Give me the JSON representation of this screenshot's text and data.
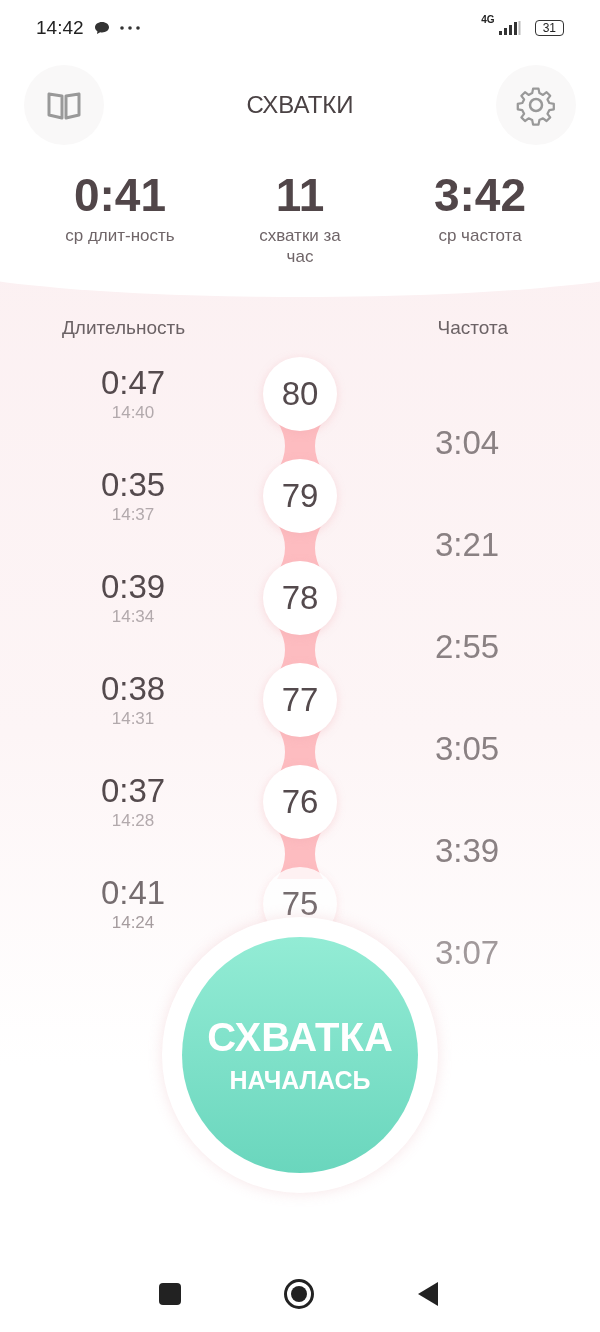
{
  "status_bar": {
    "time": "14:42",
    "network": "4G",
    "battery": "31"
  },
  "header": {
    "title": "СХВАТКИ"
  },
  "stats": [
    {
      "value": "0:41",
      "label": "ср длит-ность"
    },
    {
      "value": "11",
      "label": "схватки за час"
    },
    {
      "value": "3:42",
      "label": "ср частота"
    }
  ],
  "columns": {
    "duration": "Длительность",
    "frequency": "Частота"
  },
  "contractions": [
    {
      "duration": "0:47",
      "time": "14:40",
      "number": "80",
      "interval": "3:04"
    },
    {
      "duration": "0:35",
      "time": "14:37",
      "number": "79",
      "interval": "3:21"
    },
    {
      "duration": "0:39",
      "time": "14:34",
      "number": "78",
      "interval": "2:55"
    },
    {
      "duration": "0:38",
      "time": "14:31",
      "number": "77",
      "interval": "3:05"
    },
    {
      "duration": "0:37",
      "time": "14:28",
      "number": "76",
      "interval": "3:39"
    },
    {
      "duration": "0:41",
      "time": "14:24",
      "number": "75",
      "interval": "3:07"
    }
  ],
  "start_button": {
    "line1": "СХВАТКА",
    "line2": "НАЧАЛАСЬ"
  }
}
